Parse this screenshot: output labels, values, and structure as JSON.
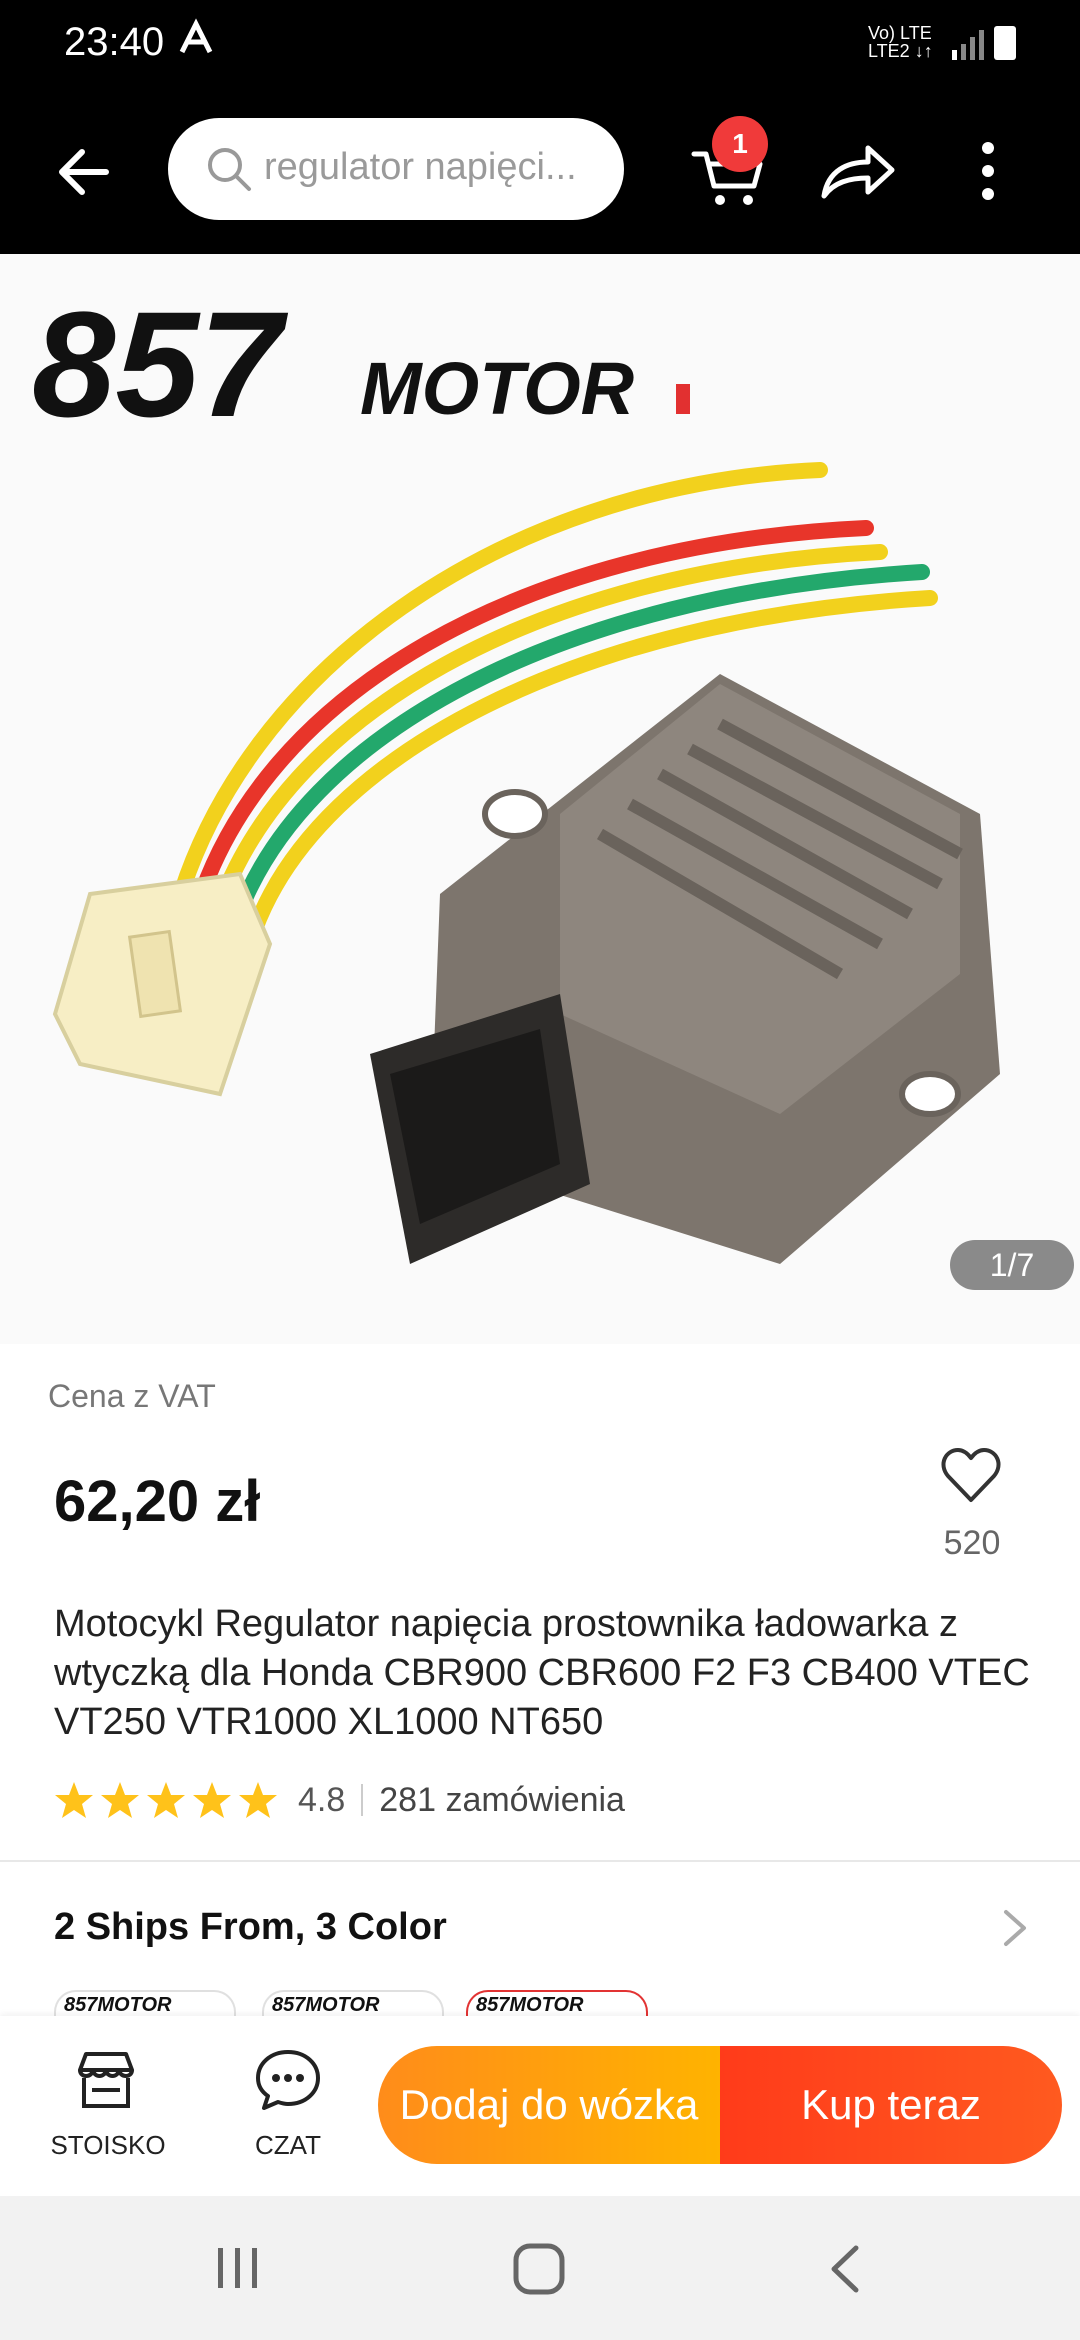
{
  "status_bar": {
    "time": "23:40",
    "network_line1": "Vo) LTE",
    "network_line2": "LTE2 ↓↑"
  },
  "top_bar": {
    "search_text": "regulator napięci...",
    "cart_badge": "1",
    "icons": [
      "back-arrow-icon",
      "search-icon",
      "cart-icon",
      "share-icon",
      "more-vert-icon"
    ]
  },
  "gallery": {
    "brand_logo": "857MOTOR",
    "image_counter": "1/7",
    "wire_colors": [
      "#f2d11d",
      "#e8352a",
      "#f2d11d",
      "#23a86c",
      "#f2d11d"
    ]
  },
  "product": {
    "vat_label": "Cena z VAT",
    "price": "62,20 zł",
    "wishlist_count": "520",
    "title": "Motocykl Regulator napięcia prostownika ładowarka z wtyczką dla Honda CBR900 CBR600 F2 F3 CB400 VTEC VT250 VTR1000 XL1000 NT650",
    "rating_value": "4.8",
    "rating_stars": 5,
    "orders": "281 zamówienia"
  },
  "variants": {
    "title": "2 Ships From, 3 Color",
    "thumb_labels": [
      "857MOTOR",
      "857MOTOR",
      "857MOTOR"
    ],
    "selected_index": 2
  },
  "action_bar": {
    "store_label": "STOISKO",
    "chat_label": "CZAT",
    "add_to_cart": "Dodaj do wózka",
    "buy_now": "Kup teraz"
  },
  "colors": {
    "accent_orange": "#ff9a0d",
    "accent_red": "#ff4520",
    "star": "#ffc21a",
    "badge": "#f03a3a"
  }
}
